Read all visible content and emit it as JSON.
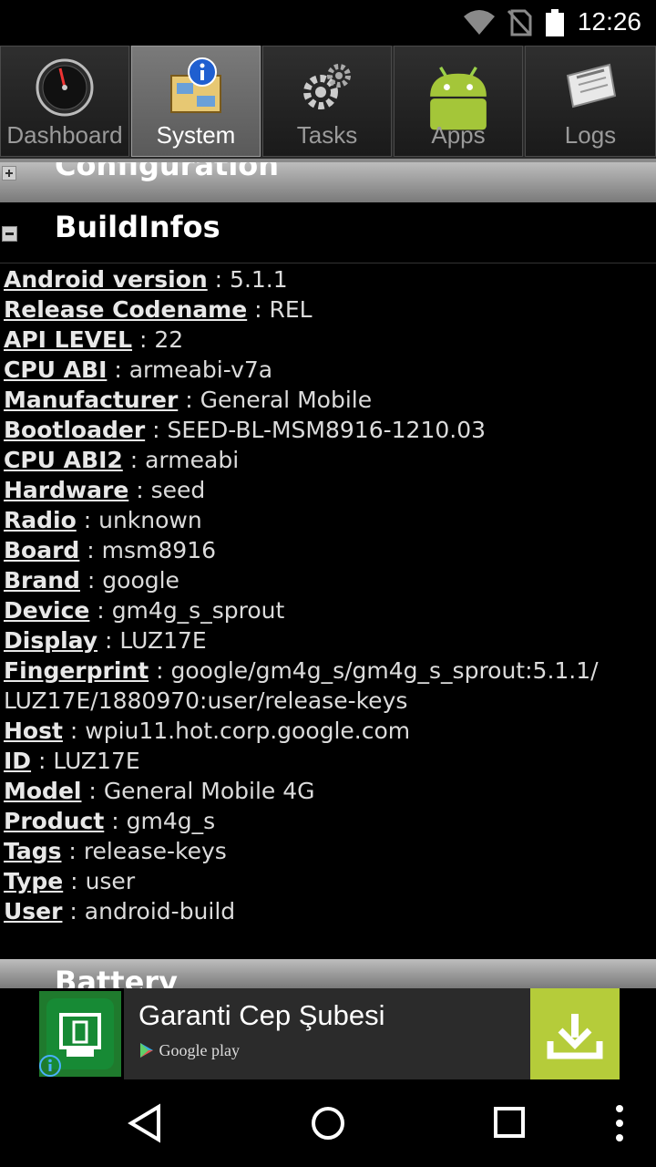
{
  "status_bar": {
    "time": "12:26",
    "icons": [
      "wifi-icon",
      "no-sim-icon",
      "battery-icon"
    ]
  },
  "tabs": [
    {
      "label": "Dashboard",
      "icon": "gauge-icon",
      "active": false
    },
    {
      "label": "System",
      "icon": "system-info-icon",
      "active": true
    },
    {
      "label": "Tasks",
      "icon": "gears-icon",
      "active": false
    },
    {
      "label": "Apps",
      "icon": "android-icon",
      "active": false
    },
    {
      "label": "Logs",
      "icon": "newspaper-icon",
      "active": false
    }
  ],
  "sections": {
    "configuration": "Configuration",
    "buildinfos": "BuildInfos",
    "battery": "Battery"
  },
  "build_infos": [
    {
      "key": "Android version",
      "value": "5.1.1"
    },
    {
      "key": "Release Codename",
      "value": "REL"
    },
    {
      "key": "API LEVEL",
      "value": "22"
    },
    {
      "key": "CPU ABI",
      "value": "armeabi-v7a"
    },
    {
      "key": "Manufacturer",
      "value": "General Mobile"
    },
    {
      "key": "Bootloader",
      "value": "SEED-BL-MSM8916-1210.03"
    },
    {
      "key": "CPU ABI2",
      "value": "armeabi"
    },
    {
      "key": "Hardware",
      "value": "seed"
    },
    {
      "key": "Radio",
      "value": "unknown"
    },
    {
      "key": "Board",
      "value": "msm8916"
    },
    {
      "key": "Brand",
      "value": "google"
    },
    {
      "key": "Device",
      "value": "gm4g_s_sprout"
    },
    {
      "key": "Display",
      "value": "LUZ17E"
    },
    {
      "key": "Fingerprint",
      "value": "google/gm4g_s/gm4g_s_sprout:5.1.1/ LUZ17E/1880970:user/release-keys"
    },
    {
      "key": "Host",
      "value": "wpiu11.hot.corp.google.com"
    },
    {
      "key": "ID",
      "value": "LUZ17E"
    },
    {
      "key": "Model",
      "value": "General Mobile 4G"
    },
    {
      "key": "Product",
      "value": "gm4g_s"
    },
    {
      "key": "Tags",
      "value": "release-keys"
    },
    {
      "key": "Type",
      "value": "user"
    },
    {
      "key": "User",
      "value": "android-build"
    }
  ],
  "ad": {
    "title": "Garanti Cep Şubesi",
    "store": "Google play",
    "accent": "#b5cc3a"
  },
  "nav": [
    "back-icon",
    "home-icon",
    "recents-icon",
    "overflow-menu-icon"
  ]
}
